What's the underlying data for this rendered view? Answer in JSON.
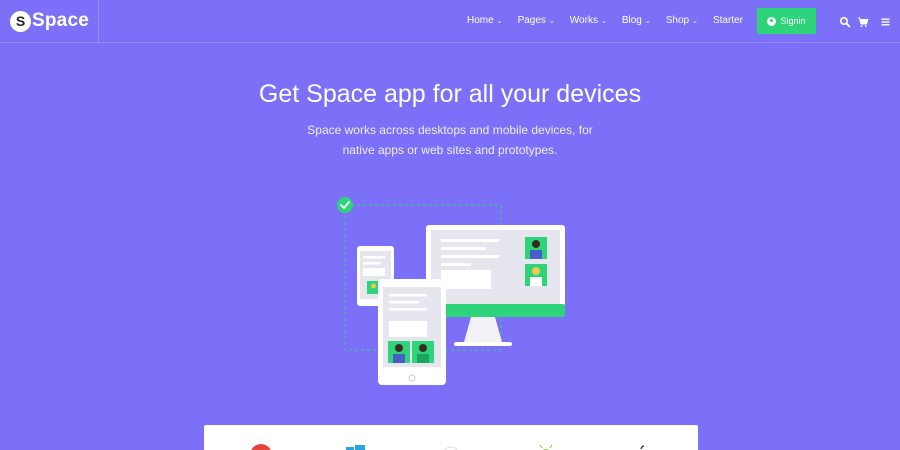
{
  "header": {
    "logo_letter": "S",
    "logo_text": "Space",
    "nav": [
      {
        "label": "Home",
        "dropdown": true
      },
      {
        "label": "Pages",
        "dropdown": true
      },
      {
        "label": "Works",
        "dropdown": true
      },
      {
        "label": "Blog",
        "dropdown": true
      },
      {
        "label": "Shop",
        "dropdown": true
      },
      {
        "label": "Starter",
        "dropdown": false
      }
    ],
    "signin_label": "Signin",
    "icons": [
      "search-icon",
      "cart-icon",
      "menu-icon"
    ]
  },
  "hero": {
    "title": "Get Space app for all your devices",
    "subtitle": "Space works across desktops and mobile devices, for native apps or web sites and prototypes."
  },
  "brands": [
    "google-icon",
    "windows-icon",
    "chrome-icon",
    "android-icon",
    "apple-icon"
  ],
  "colors": {
    "background": "#7b70f7",
    "accent_green": "#2ed47a",
    "white": "#ffffff"
  }
}
